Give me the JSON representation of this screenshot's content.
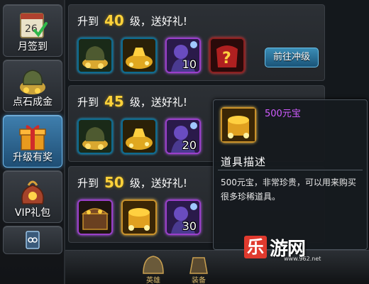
{
  "sidebar": {
    "tabs": [
      {
        "label": "月签到",
        "icon": "calendar-icon"
      },
      {
        "label": "点石成金",
        "icon": "money-bag-icon"
      },
      {
        "label": "升级有奖",
        "icon": "gift-box-icon",
        "active": true
      },
      {
        "label": "VIP礼包",
        "icon": "vip-bag-icon"
      },
      {
        "label": "",
        "icon": "card-icon"
      }
    ]
  },
  "rows": [
    {
      "prefix": "升到",
      "level": "40",
      "suffix": "级，送好礼!",
      "items": [
        {
          "icon": "money-bag-icon",
          "count": ""
        },
        {
          "icon": "gold-ingot-icon",
          "count": ""
        },
        {
          "icon": "hero-card-icon",
          "count": "10"
        },
        {
          "icon": "mystery-armor-icon",
          "count": ""
        }
      ],
      "button": "前往冲级"
    },
    {
      "prefix": "升到",
      "level": "45",
      "suffix": "级，送好礼!",
      "items": [
        {
          "icon": "money-bag-icon",
          "count": ""
        },
        {
          "icon": "gold-ingot-icon",
          "count": ""
        },
        {
          "icon": "hero-card-icon",
          "count": "20"
        }
      ]
    },
    {
      "prefix": "升到",
      "level": "50",
      "suffix": "级，送好礼!",
      "items": [
        {
          "icon": "treasure-chest-icon",
          "count": ""
        },
        {
          "icon": "gold-treasure-icon",
          "count": ""
        },
        {
          "icon": "hero-card-icon",
          "count": "30"
        }
      ]
    }
  ],
  "tooltip": {
    "name": "500元宝",
    "title": "道具描述",
    "description": "500元宝，非常珍贵，可以用来购买很多珍稀道具。",
    "name_color": "#d05cff"
  },
  "bottom_bar": [
    {
      "label": "英雄"
    },
    {
      "label": "装备"
    }
  ],
  "watermark": {
    "logo": "乐",
    "text": "游网",
    "url": "www.962.net"
  },
  "colors": {
    "level": "#ffd23a",
    "active_tab": "#3f7fae",
    "accent_button": "#3b8db6"
  }
}
